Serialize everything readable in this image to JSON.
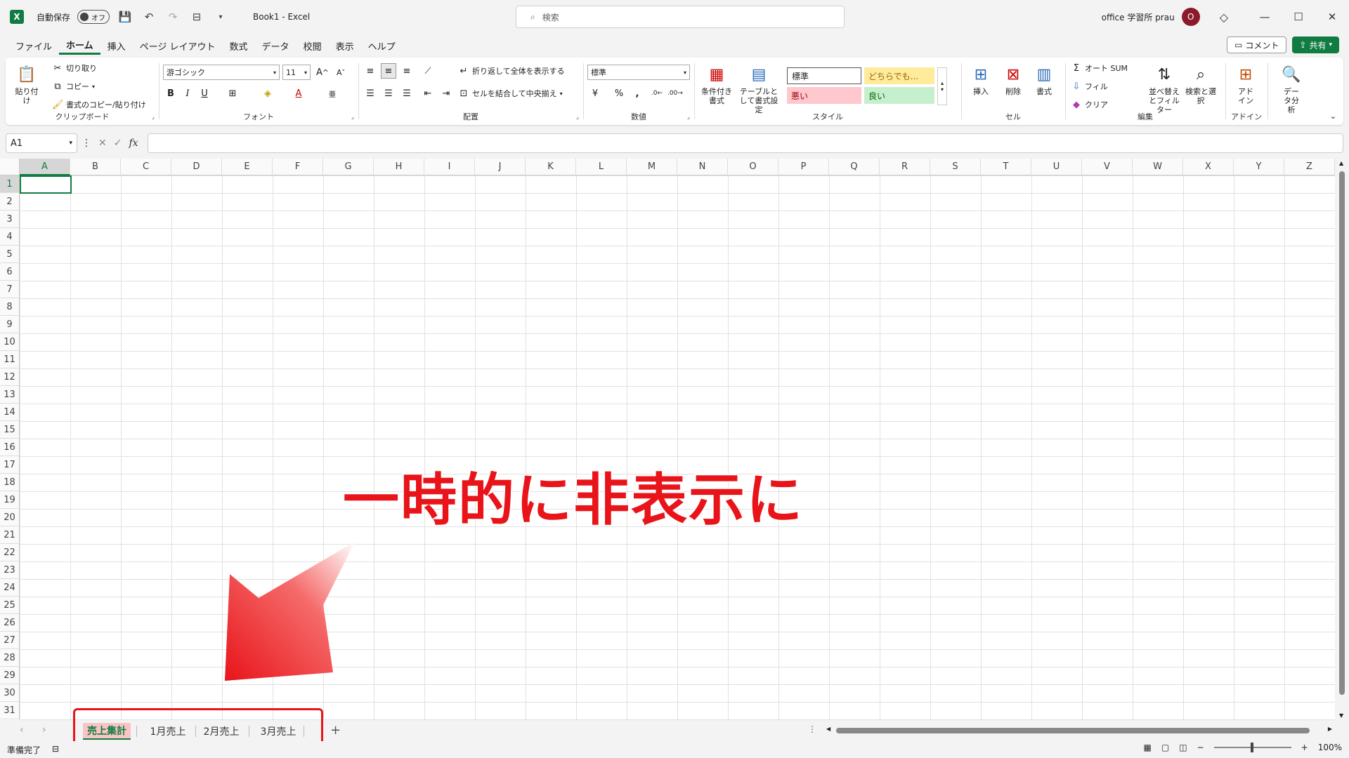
{
  "titlebar": {
    "autosave_label": "自動保存",
    "autosave_state": "オフ",
    "doc_title": "Book1  -  Excel",
    "search_placeholder": "検索",
    "user_name": "office 学習所 prau",
    "avatar_initial": "O"
  },
  "tabs": [
    "ファイル",
    "ホーム",
    "挿入",
    "ページ レイアウト",
    "数式",
    "データ",
    "校閲",
    "表示",
    "ヘルプ"
  ],
  "active_tab": "ホーム",
  "actions": {
    "comment": "コメント",
    "share": "共有"
  },
  "ribbon": {
    "clipboard": {
      "label": "クリップボード",
      "paste": "貼り付け",
      "cut": "切り取り",
      "copy": "コピー",
      "format_painter": "書式のコピー/貼り付け"
    },
    "font": {
      "label": "フォント",
      "font_name": "游ゴシック",
      "font_size": "11"
    },
    "alignment": {
      "label": "配置",
      "wrap": "折り返して全体を表示する",
      "merge": "セルを結合して中央揃え"
    },
    "number": {
      "label": "数値",
      "format": "標準"
    },
    "styles": {
      "label": "スタイル",
      "conditional": "条件付き書式",
      "table": "テーブルとして書式設定",
      "normal": "標準",
      "neutral": "どちらでも...",
      "bad": "悪い",
      "good": "良い"
    },
    "cells": {
      "label": "セル",
      "insert": "挿入",
      "delete": "削除",
      "format": "書式"
    },
    "editing": {
      "label": "編集",
      "autosum": "オート SUM",
      "fill": "フィル",
      "clear": "クリア",
      "sort": "並べ替えとフィルター",
      "find": "検索と選択"
    },
    "addins": {
      "label": "アドイン",
      "addin": "アドイン"
    },
    "analysis": {
      "data_analysis": "データ分析"
    }
  },
  "formula_bar": {
    "name_box": "A1",
    "fx": "fx"
  },
  "columns": [
    "A",
    "B",
    "C",
    "D",
    "E",
    "F",
    "G",
    "H",
    "I",
    "J",
    "K",
    "L",
    "M",
    "N",
    "O",
    "P",
    "Q",
    "R",
    "S",
    "T",
    "U",
    "V",
    "W",
    "X",
    "Y",
    "Z"
  ],
  "rows": [
    "1",
    "2",
    "3",
    "4",
    "5",
    "6",
    "7",
    "8",
    "9",
    "10",
    "11",
    "12",
    "13",
    "14",
    "15",
    "16",
    "17",
    "18",
    "19",
    "20",
    "21",
    "22",
    "23",
    "24",
    "25",
    "26",
    "27",
    "28",
    "29",
    "30",
    "31"
  ],
  "annotation": "一時的に非表示に",
  "sheets": [
    "売上集計",
    "1月売上",
    "2月売上",
    "3月売上"
  ],
  "status": {
    "ready": "準備完了",
    "zoom": "100%"
  },
  "colors": {
    "accent": "#107c41",
    "annotation": "#e8141a"
  }
}
